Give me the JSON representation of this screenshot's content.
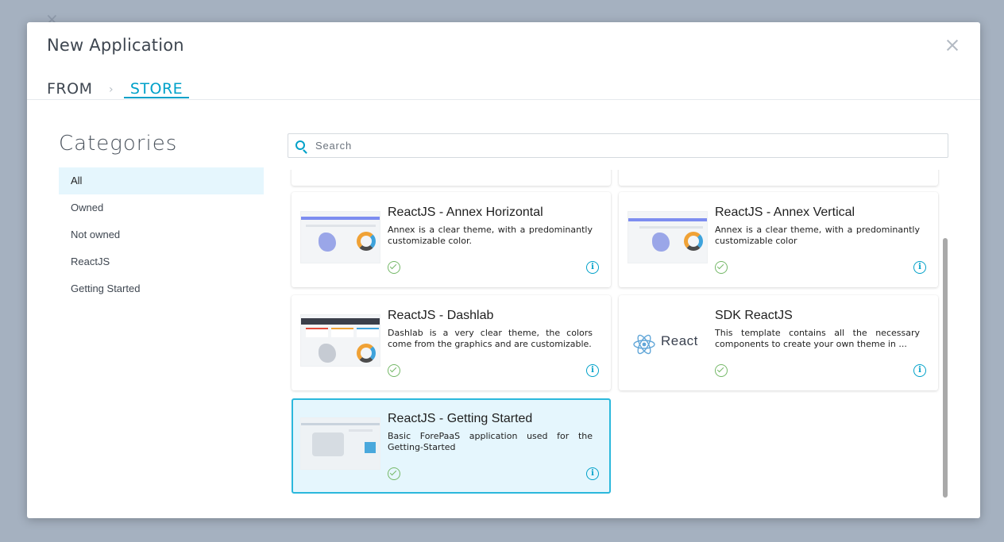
{
  "modal": {
    "title": "New Application",
    "breadcrumb": {
      "from": "FROM",
      "separator": "›",
      "current": "STORE"
    }
  },
  "categories": {
    "title": "Categories",
    "items": [
      {
        "label": "All",
        "active": true
      },
      {
        "label": "Owned",
        "active": false
      },
      {
        "label": "Not owned",
        "active": false
      },
      {
        "label": "ReactJS",
        "active": false
      },
      {
        "label": "Getting Started",
        "active": false
      }
    ]
  },
  "search": {
    "placeholder": "Search",
    "value": ""
  },
  "cards": [
    {
      "title": "ReactJS - Annex Horizontal",
      "description": "Annex is a clear theme, with a predominantly customizable color.",
      "owned": true,
      "selected": false,
      "thumbnail": "annex-horizontal-thumbnail"
    },
    {
      "title": "ReactJS - Annex Vertical",
      "description": "Annex is a clear theme, with a predominantly customizable color",
      "owned": true,
      "selected": false,
      "thumbnail": "annex-vertical-thumbnail"
    },
    {
      "title": "ReactJS - Dashlab",
      "description": "Dashlab is a very clear theme, the colors come from the graphics and are customizable.",
      "owned": true,
      "selected": false,
      "thumbnail": "dashlab-thumbnail"
    },
    {
      "title": "SDK ReactJS",
      "description": "This template contains all the necessary components to create your own theme in ...",
      "owned": true,
      "selected": false,
      "thumbnail": "react-logo",
      "logo_text": "React"
    },
    {
      "title": "ReactJS - Getting Started",
      "description": "Basic ForePaaS application used for the Getting-Started",
      "owned": true,
      "selected": true,
      "thumbnail": "getting-started-thumbnail"
    }
  ],
  "icons": {
    "close": "close-icon",
    "search": "search-icon",
    "owned": "check-circle-icon",
    "info": "info-icon",
    "info_glyph": "i"
  },
  "colors": {
    "accent": "#00a1c9",
    "selected_bg": "#e5f6fd",
    "selected_border": "#2bb8dc",
    "owned_check": "#74b867",
    "backdrop": "#a5b1c0"
  }
}
